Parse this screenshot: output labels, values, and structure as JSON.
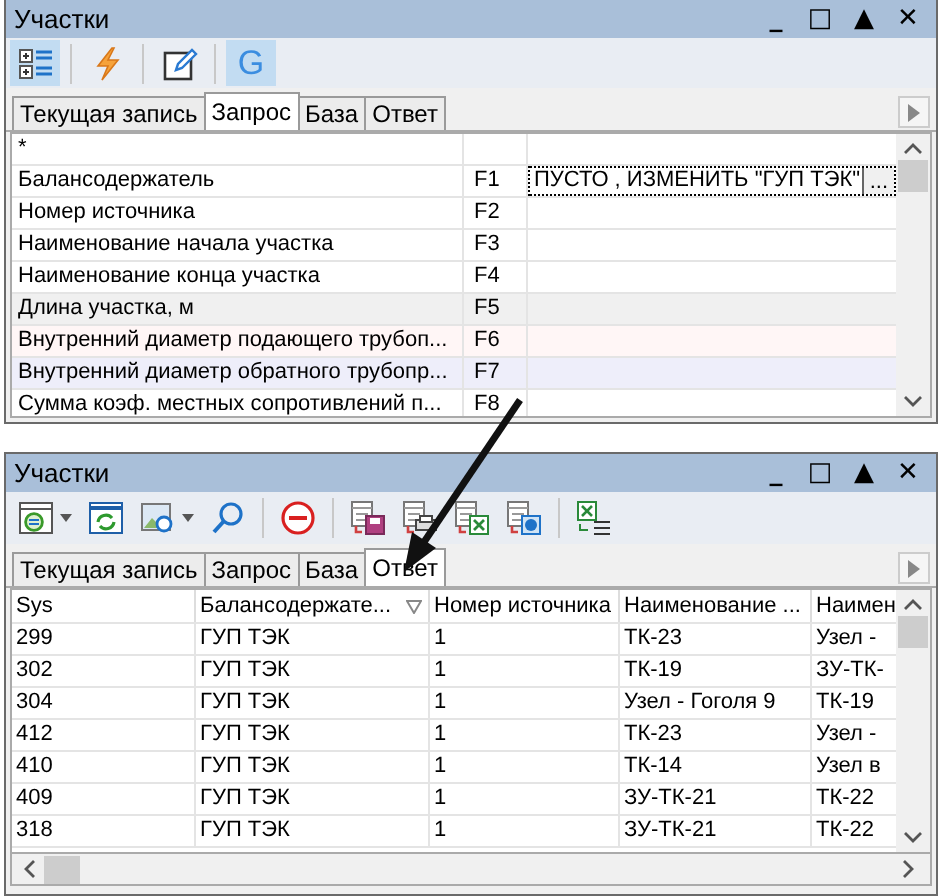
{
  "top_panel": {
    "title": "Участки",
    "controls": [
      "_",
      "□",
      "▲",
      "✕"
    ],
    "toolbar": [
      {
        "kind": "tree",
        "pressed": true
      },
      {
        "kind": "lightning",
        "pressed": false
      },
      {
        "kind": "edit",
        "pressed": false
      },
      {
        "kind": "letter",
        "label": "G",
        "pressed": true
      }
    ],
    "tabs": [
      {
        "label": "Текущая запись",
        "selected": false
      },
      {
        "label": "Запрос",
        "selected": true
      },
      {
        "label": "База",
        "selected": false
      },
      {
        "label": "Ответ",
        "selected": false
      }
    ],
    "rows": [
      {
        "field": "*",
        "code": ""
      },
      {
        "field": "Балансодержатель",
        "code": "F1",
        "value": "ПУСТО ,  ИЗМЕНИТЬ \"ГУП ТЭК\"",
        "editing": true,
        "button": "..."
      },
      {
        "field": "Номер источника",
        "code": "F2"
      },
      {
        "field": "Наименование начала участка",
        "code": "F3"
      },
      {
        "field": "Наименование конца участка",
        "code": "F4"
      },
      {
        "field": "Длина участка, м",
        "code": "F5",
        "color": "#f0f0f0"
      },
      {
        "field": "Внутренний диаметр подающего трубоп...",
        "code": "F6",
        "color": "#fff6f6"
      },
      {
        "field": "Внутренний диаметр обратного трубопр...",
        "code": "F7",
        "color": "#eeeefa"
      },
      {
        "field": "Сумма коэф. местных сопротивлений п...",
        "code": "F8"
      }
    ]
  },
  "bottom_panel": {
    "title": "Участки",
    "controls": [
      "_",
      "□",
      "▲",
      "✕"
    ],
    "toolbar": [
      {
        "kind": "grid-refresh",
        "caret": true
      },
      {
        "kind": "refresh"
      },
      {
        "kind": "picture",
        "caret": true
      },
      {
        "kind": "search"
      },
      {
        "kind": "stop"
      },
      {
        "kind": "save"
      },
      {
        "kind": "print"
      },
      {
        "kind": "excel"
      },
      {
        "kind": "globe"
      },
      {
        "kind": "excel-list"
      }
    ],
    "tabs": [
      {
        "label": "Текущая запись",
        "selected": false
      },
      {
        "label": "Запрос",
        "selected": false
      },
      {
        "label": "База",
        "selected": false
      },
      {
        "label": "Ответ",
        "selected": true
      }
    ],
    "columns": [
      {
        "label": "Sys"
      },
      {
        "label": "Балансодержате...",
        "sorted": true
      },
      {
        "label": "Номер источника"
      },
      {
        "label": "Наименование ..."
      },
      {
        "label": "Наимен"
      }
    ],
    "rows": [
      [
        "299",
        "ГУП ТЭК",
        "1",
        "ТК-23",
        "Узел -"
      ],
      [
        "302",
        "ГУП ТЭК",
        "1",
        "ТК-19",
        "ЗУ-ТК-"
      ],
      [
        "304",
        "ГУП ТЭК",
        "1",
        "Узел - Гоголя 9",
        "ТК-19"
      ],
      [
        "412",
        "ГУП ТЭК",
        "1",
        "ТК-23",
        "Узел -"
      ],
      [
        "410",
        "ГУП ТЭК",
        "1",
        "ТК-14",
        "Узел в"
      ],
      [
        "409",
        "ГУП ТЭК",
        "1",
        "ЗУ-ТК-21",
        "ТК-22"
      ],
      [
        "318",
        "ГУП ТЭК",
        "1",
        "ЗУ-ТК-21",
        "ТК-22"
      ]
    ]
  }
}
